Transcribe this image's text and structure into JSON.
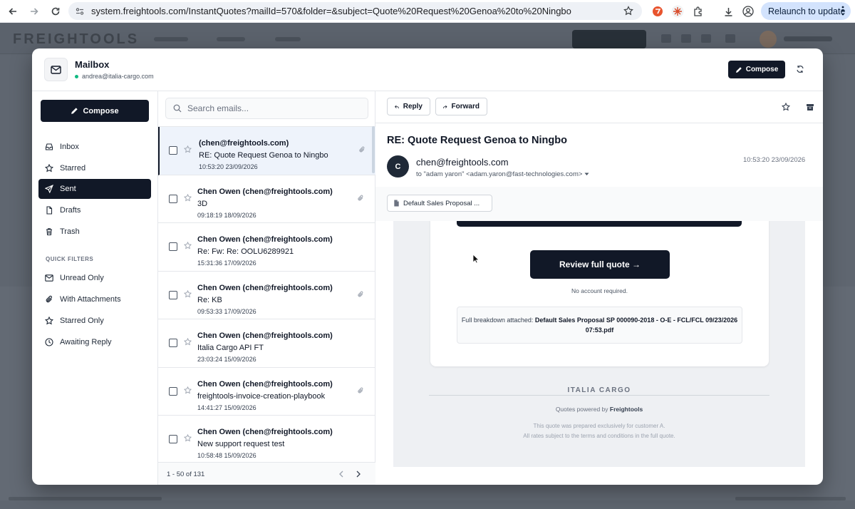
{
  "browser": {
    "url": "system.freightools.com/InstantQuotes?mailId=570&folder=&subject=Quote%20Request%20Genoa%20to%20Ningbo",
    "relaunch_label": "Relaunch to update"
  },
  "mailbox": {
    "title": "Mailbox",
    "account": "andrea@italia-cargo.com",
    "compose_label": "Compose"
  },
  "sidebar": {
    "compose_label": "Compose",
    "folders": [
      {
        "label": "Inbox",
        "icon": "inbox-icon"
      },
      {
        "label": "Starred",
        "icon": "star-icon"
      },
      {
        "label": "Sent",
        "icon": "send-icon",
        "active": true
      },
      {
        "label": "Drafts",
        "icon": "file-icon"
      },
      {
        "label": "Trash",
        "icon": "trash-icon"
      }
    ],
    "quick_filters_label": "QUICK FILTERS",
    "filters": [
      {
        "label": "Unread Only",
        "icon": "mail-icon"
      },
      {
        "label": "With Attachments",
        "icon": "paperclip-icon"
      },
      {
        "label": "Starred Only",
        "icon": "star-icon"
      },
      {
        "label": "Awaiting Reply",
        "icon": "clock-icon"
      }
    ]
  },
  "list": {
    "search_placeholder": "Search emails...",
    "emails": [
      {
        "from": "(chen@freightools.com)",
        "subject": "RE: Quote Request Genoa to Ningbo",
        "time": "10:53:20 23/09/2026",
        "attachment": true,
        "selected": true
      },
      {
        "from": "Chen Owen (chen@freightools.com)",
        "subject": "3D",
        "time": "09:18:19 18/09/2026",
        "attachment": true
      },
      {
        "from": "Chen Owen (chen@freightools.com)",
        "subject": "Re: Fw: Re: OOLU6289921",
        "time": "15:31:36 17/09/2026",
        "attachment": false
      },
      {
        "from": "Chen Owen (chen@freightools.com)",
        "subject": "Re: KB",
        "time": "09:53:33 17/09/2026",
        "attachment": true
      },
      {
        "from": "Chen Owen (chen@freightools.com)",
        "subject": "Italia Cargo API FT",
        "time": "23:03:24 15/09/2026",
        "attachment": false
      },
      {
        "from": "Chen Owen (chen@freightools.com)",
        "subject": "freightools-invoice-creation-playbook",
        "time": "14:41:27 15/09/2026",
        "attachment": true
      },
      {
        "from": "Chen Owen (chen@freightools.com)",
        "subject": "New support request test",
        "time": "10:58:48 15/09/2026",
        "attachment": false
      }
    ],
    "pagination": "1 - 50 of 131"
  },
  "reader": {
    "reply_label": "Reply",
    "forward_label": "Forward",
    "subject": "RE: Quote Request Genoa to Ningbo",
    "avatar_letter": "C",
    "from": "chen@freightools.com",
    "to": "to \"adam yaron\" <adam.yaron@fast-technologies.com>",
    "date": "10:53:20 23/09/2026",
    "attachment_name": "Default Sales Proposal ...",
    "body": {
      "review_button": "Review full quote →",
      "no_account": "No account required.",
      "breakdown_prefix": "Full breakdown attached:",
      "breakdown_file": "Default Sales Proposal SP 000090-2018 - O-E - FCL/FCL 09/23/2026 07:53.pdf",
      "brand": "ITALIA CARGO",
      "powered_prefix": "Quotes powered by",
      "powered_brand": "Freightools",
      "note1": "This quote was prepared exclusively for customer A.",
      "note2": "All rates subject to the terms and conditions in the full quote."
    }
  },
  "background": {
    "logo": "FREIGHTOOLS"
  }
}
